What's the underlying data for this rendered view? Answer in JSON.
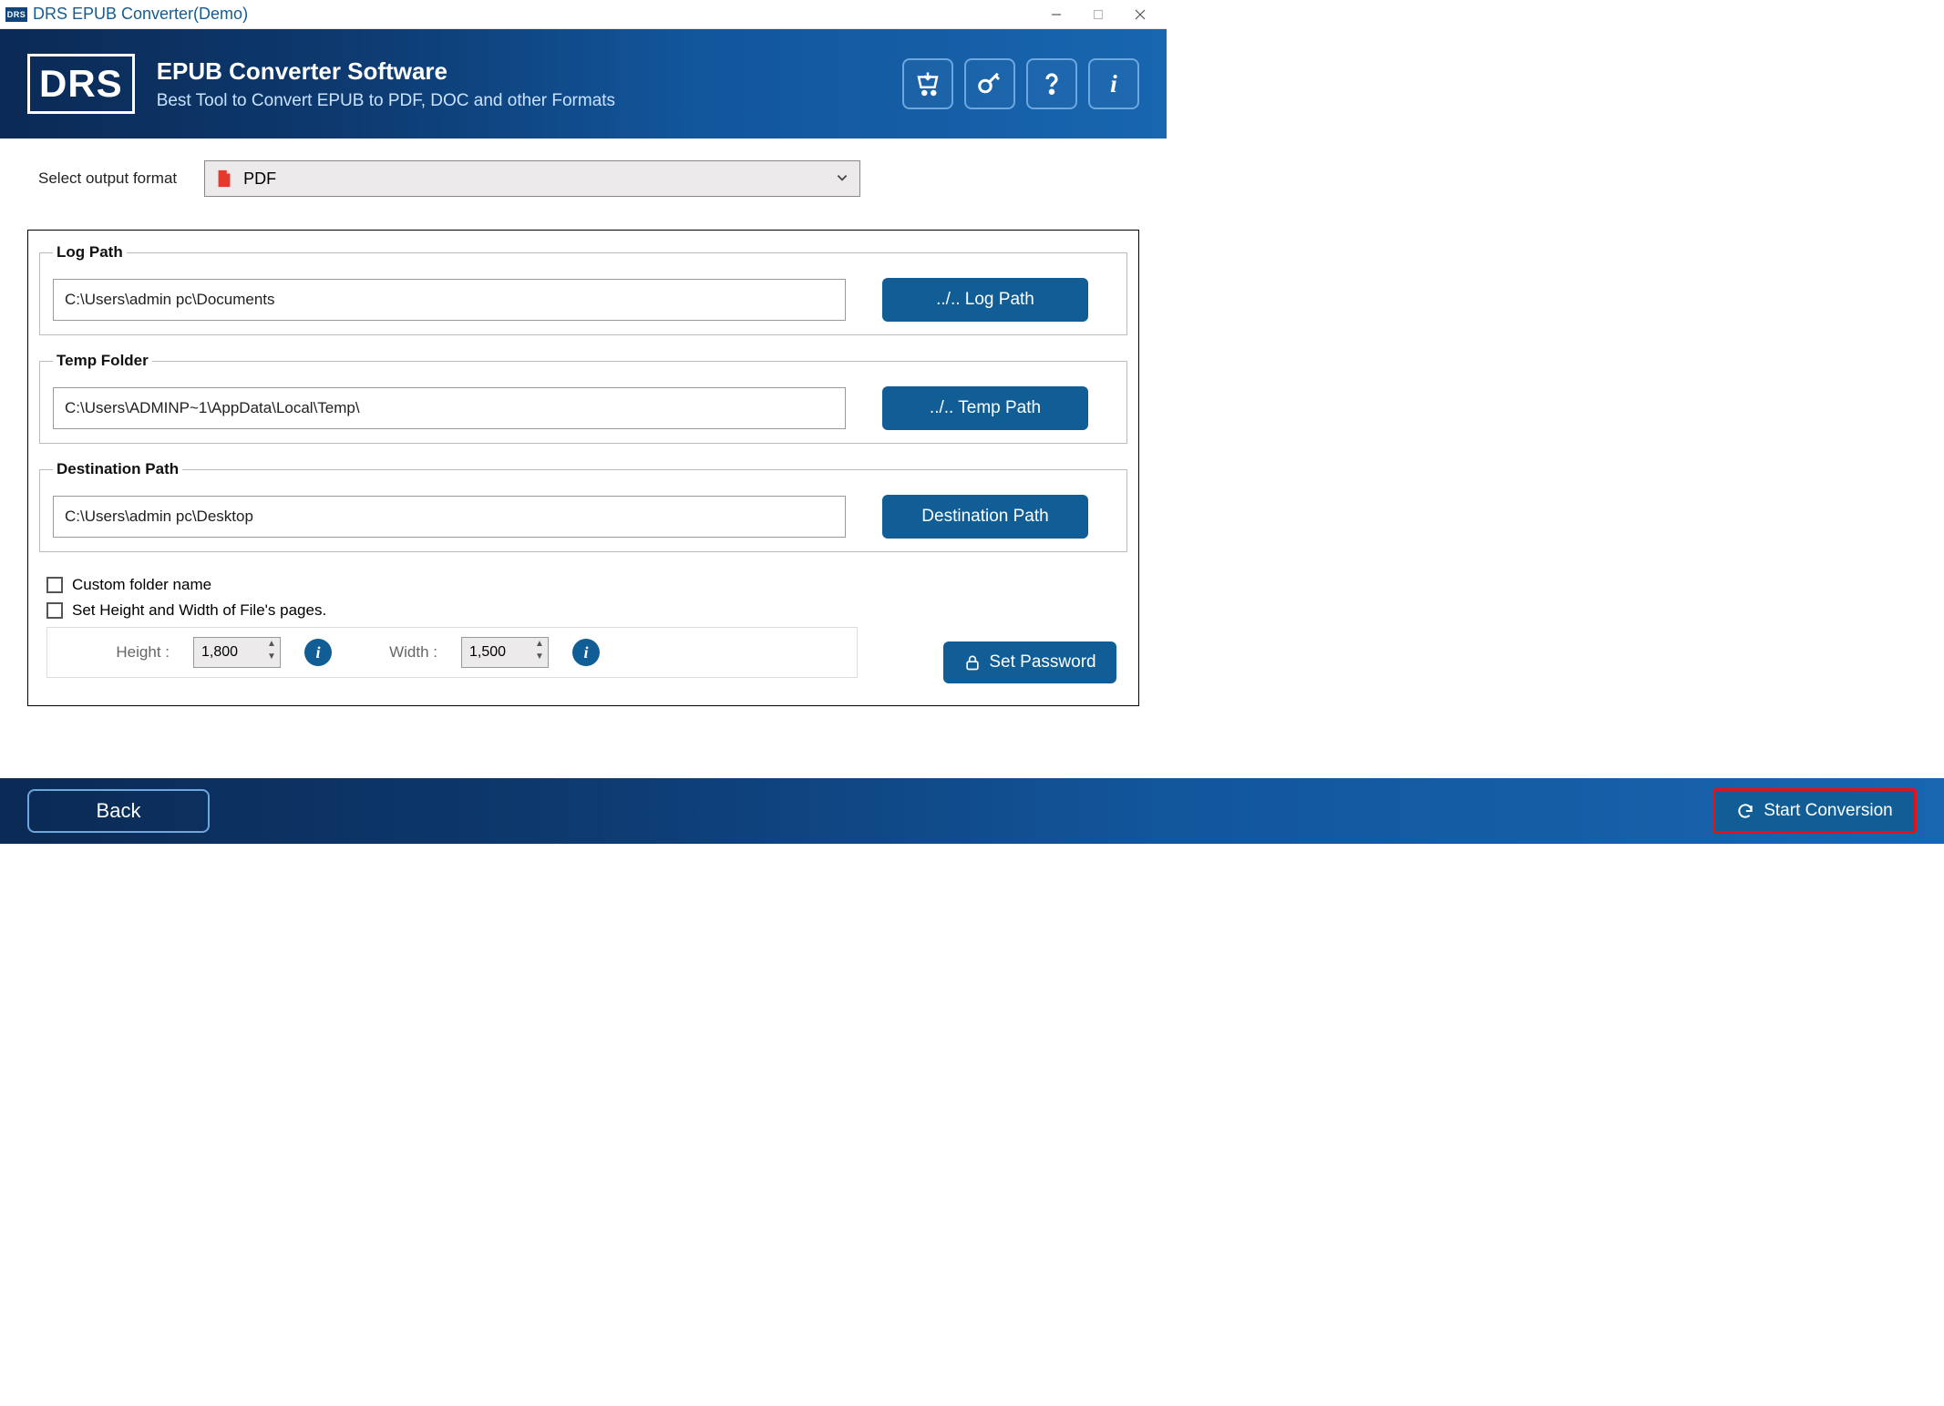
{
  "titlebar": {
    "logo_text": "DRS",
    "title": "DRS EPUB Converter(Demo)"
  },
  "banner": {
    "logo": "DRS",
    "title": "EPUB Converter Software",
    "subtitle": "Best Tool to Convert EPUB to PDF, DOC and other Formats",
    "icons": [
      "cart-icon",
      "key-icon",
      "help-icon",
      "info-icon"
    ]
  },
  "format": {
    "label": "Select output format",
    "selected": "PDF"
  },
  "groups": {
    "log": {
      "legend": "Log Path",
      "path": "C:\\Users\\admin pc\\Documents",
      "button": "../.. Log Path"
    },
    "temp": {
      "legend": "Temp Folder",
      "path": "C:\\Users\\ADMINP~1\\AppData\\Local\\Temp\\",
      "button": "../.. Temp Path"
    },
    "dest": {
      "legend": "Destination Path",
      "path": "C:\\Users\\admin pc\\Desktop",
      "button": "Destination Path"
    }
  },
  "options": {
    "custom_folder": "Custom folder name",
    "set_hw": "Set Height and Width of File's pages.",
    "height_label": "Height :",
    "height_value": "1,800",
    "width_label": "Width :",
    "width_value": "1,500",
    "info_glyph": "i",
    "set_password": "Set Password"
  },
  "footer": {
    "back": "Back",
    "start": "Start Conversion"
  }
}
